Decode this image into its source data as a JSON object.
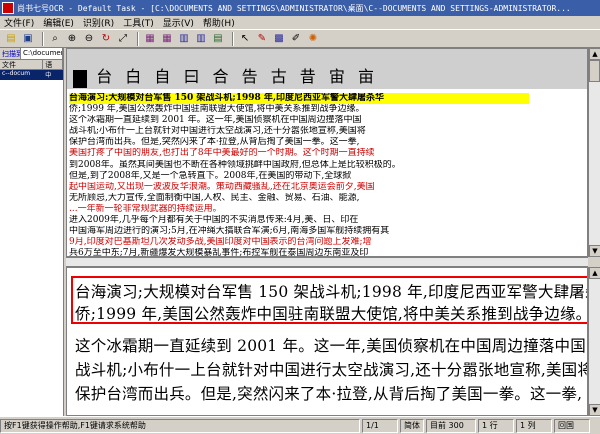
{
  "window": {
    "title": "尚书七号OCR - Default Task - [C:\\DOCUMENTS AND SETTINGS\\ADMINISTRATOR\\桌面\\C--DOCUMENTS AND SETTINGS-ADMINISTRATOR..."
  },
  "menu": [
    "文件(F)",
    "编辑(E)",
    "识别(R)",
    "工具(T)",
    "显示(V)",
    "帮助(H)"
  ],
  "toolbar": {
    "icons": [
      "open-icon",
      "save-icon",
      "zoom-icon",
      "zoom-in-icon",
      "zoom-out-icon",
      "rotate-icon",
      "fit-icon",
      "page-icon",
      "layout-icon",
      "select-icon",
      "column-icon",
      "table-icon",
      "arrow-icon",
      "pen-icon",
      "recognize-icon",
      "brush-icon",
      "palette-icon"
    ]
  },
  "left_pane": {
    "tabs": [
      "扫描到",
      "C:\\documents"
    ],
    "columns": [
      "文件",
      "语"
    ],
    "rows": [
      {
        "file": "c--docum",
        "lang": "中"
      }
    ]
  },
  "image_pane": {
    "header_text": "台 白 自 曰  合 告 古 昔  宙 亩",
    "highlight_line": "台海演习:大规模对台军售 150 架战斗机;1998 年,印度尼西亚军警大肆屠杀华",
    "lines": [
      "侨;1999 年,美国公然轰炸中国驻南联盟大使馆,将中美关系推到战争边缘。",
      "    这个冰霜期一直延续到 2001 年。这一年,美国侦察机在中国周边撞落中国",
      "战斗机;小布什一上台就针对中国进行太空战演习,还十分嚣张地宣称,美国将",
      "保护台湾而出兵。但是,突然闪来了本·拉登,从背后掏了美国一拳。这一拳,",
      "美国打疼了中国的朋友,也打出了8年中美最好的一个时期。这个时期一直持续",
      "到2008年。虽然其间美国也不断在各种领域挑衅中国政府,但总体上是比较积极的。",
      "    但是,到了2008年,又是一个急转直下。2008年,在美国的带动下,全球掀",
      "起中国运动,又出现一波波反华浪潮。策动西藏骚乱,还在北京奥运会前夕,美国",
      "无所顾忌,大力宣传,全面制衡中国,人权、民主、金融、贸易、石油、能源,",
      "...一年新一轮非常规武器的持续运用。",
      "    进入2009年,几乎每个月都有关于中国的不实消息传来:4月,美、日、印在",
      "中国海军周边进行的演习;5月,在冲绳大搞联合军演;6月,南海多国军舰持续拥有其",
      "9月,印度对巴基斯坦几次发动多战,美国印度对中国表示的台湾问题上发难;增",
      "兵6万至中东;7月,新疆爆发大规模暴乱事件;布控军舰在泰国周边东南亚及印"
    ]
  },
  "text_pane": {
    "lines": [
      "台海演习;大规模对台军售 150 架战斗机;1998 年,印度尼西亚军警大肆屠杀华",
      "侨;1999 年,美国公然轰炸中国驻南联盟大使馆,将中美关系推到战争边缘。",
      "    这个冰霜期一直延续到 2001 年。这一年,美国侦察机在中国周边撞落中国",
      "战斗机;小布什一上台就针对中国进行太空战演习,还十分嚣张地宣称,美国将",
      "保护台湾而出兵。但是,突然闪来了本·拉登,从背后掏了美国一拳。这一拳,"
    ]
  },
  "status": {
    "hint": "按F1键获得操作帮助,F1键请求系统帮助",
    "page": "1/1",
    "lang": "简体",
    "dpi_label": "目前",
    "dpi": "300",
    "row": "行",
    "row_val": "1",
    "col": "列",
    "col_val": "1",
    "mode": "回国"
  },
  "colors": {
    "title_bg": "#3a5ea8",
    "highlight": "#ffff00",
    "red_text": "#d00000",
    "selection_border": "#e00000"
  }
}
